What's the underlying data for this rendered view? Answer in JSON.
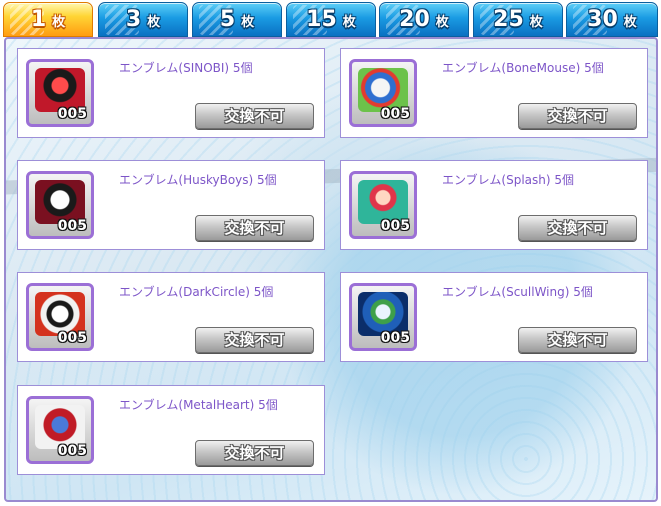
{
  "tabs": [
    {
      "num": "1",
      "unit": "枚",
      "active": true
    },
    {
      "num": "3",
      "unit": "枚",
      "active": false
    },
    {
      "num": "5",
      "unit": "枚",
      "active": false
    },
    {
      "num": "15",
      "unit": "枚",
      "active": false
    },
    {
      "num": "20",
      "unit": "枚",
      "active": false
    },
    {
      "num": "25",
      "unit": "枚",
      "active": false
    },
    {
      "num": "30",
      "unit": "枚",
      "active": false
    }
  ],
  "items": [
    {
      "title": "エンブレム(SINOBI) 5個",
      "count": "005",
      "button": "交換不可",
      "icon": "sinobi-emblem-icon",
      "color": "#c0182a"
    },
    {
      "title": "エンブレム(BoneMouse) 5個",
      "count": "005",
      "button": "交換不可",
      "icon": "bonemouse-emblem-icon",
      "color": "#2f6fd0"
    },
    {
      "title": "エンブレム(HuskyBoys) 5個",
      "count": "005",
      "button": "交換不可",
      "icon": "huskyboys-emblem-icon",
      "color": "#7a1020"
    },
    {
      "title": "エンブレム(Splash) 5個",
      "count": "005",
      "button": "交換不可",
      "icon": "splash-emblem-icon",
      "color": "#2fb59a"
    },
    {
      "title": "エンブレム(DarkCircle) 5個",
      "count": "005",
      "button": "交換不可",
      "icon": "darkcircle-emblem-icon",
      "color": "#d4321e"
    },
    {
      "title": "エンブレム(ScullWing) 5個",
      "count": "005",
      "button": "交換不可",
      "icon": "scullwing-emblem-icon",
      "color": "#1f5fb8"
    },
    {
      "title": "エンブレム(MetalHeart) 5個",
      "count": "005",
      "button": "交換不可",
      "icon": "metalheart-emblem-icon",
      "color": "#c01b26"
    }
  ]
}
